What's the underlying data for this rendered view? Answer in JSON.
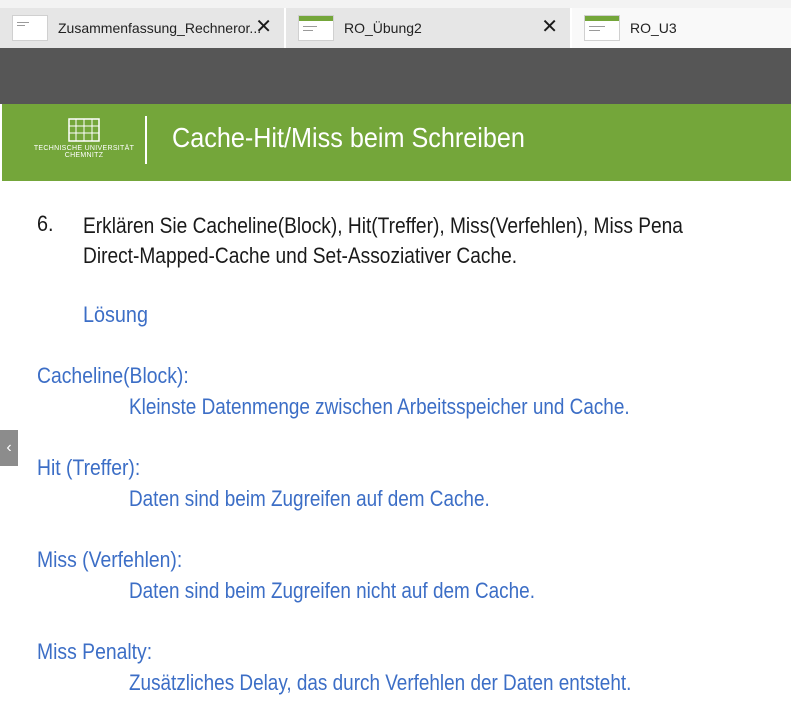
{
  "tabs": [
    {
      "title": "Zusammenfassung_Rechneror...",
      "close": "✕",
      "active": false
    },
    {
      "title": "RO_Übung2",
      "close": "✕",
      "active": false
    },
    {
      "title": "RO_U3",
      "active": true
    }
  ],
  "slide": {
    "logo": {
      "line1": "TECHNISCHE UNIVERSITÄT",
      "line2": "CHEMNITZ"
    },
    "title": "Cache-Hit/Miss beim Schreiben",
    "question": {
      "number": "6.",
      "line1": "Erklären Sie Cacheline(Block), Hit(Treffer), Miss(Verfehlen), Miss Pena",
      "line2": "Direct-Mapped-Cache und Set-Assoziativer Cache."
    },
    "solution_label": "Lösung",
    "definitions": [
      {
        "term": "Cacheline(Block):",
        "text": "Kleinste Datenmenge zwischen Arbeitsspeicher und Cache."
      },
      {
        "term": "Hit (Treffer):",
        "text": "Daten sind beim Zugreifen auf dem Cache."
      },
      {
        "term": "Miss (Verfehlen):",
        "text": "Daten sind beim Zugreifen nicht auf dem Cache."
      },
      {
        "term": "Miss Penalty:",
        "text": "Zusätzliches Delay, das durch Verfehlen der Daten entsteht."
      }
    ]
  },
  "side_handle_icon": "chevron-left-icon",
  "colors": {
    "header_green": "#74a63a",
    "solution_blue": "#3c6ec6",
    "dark_toolbar": "#565656"
  }
}
